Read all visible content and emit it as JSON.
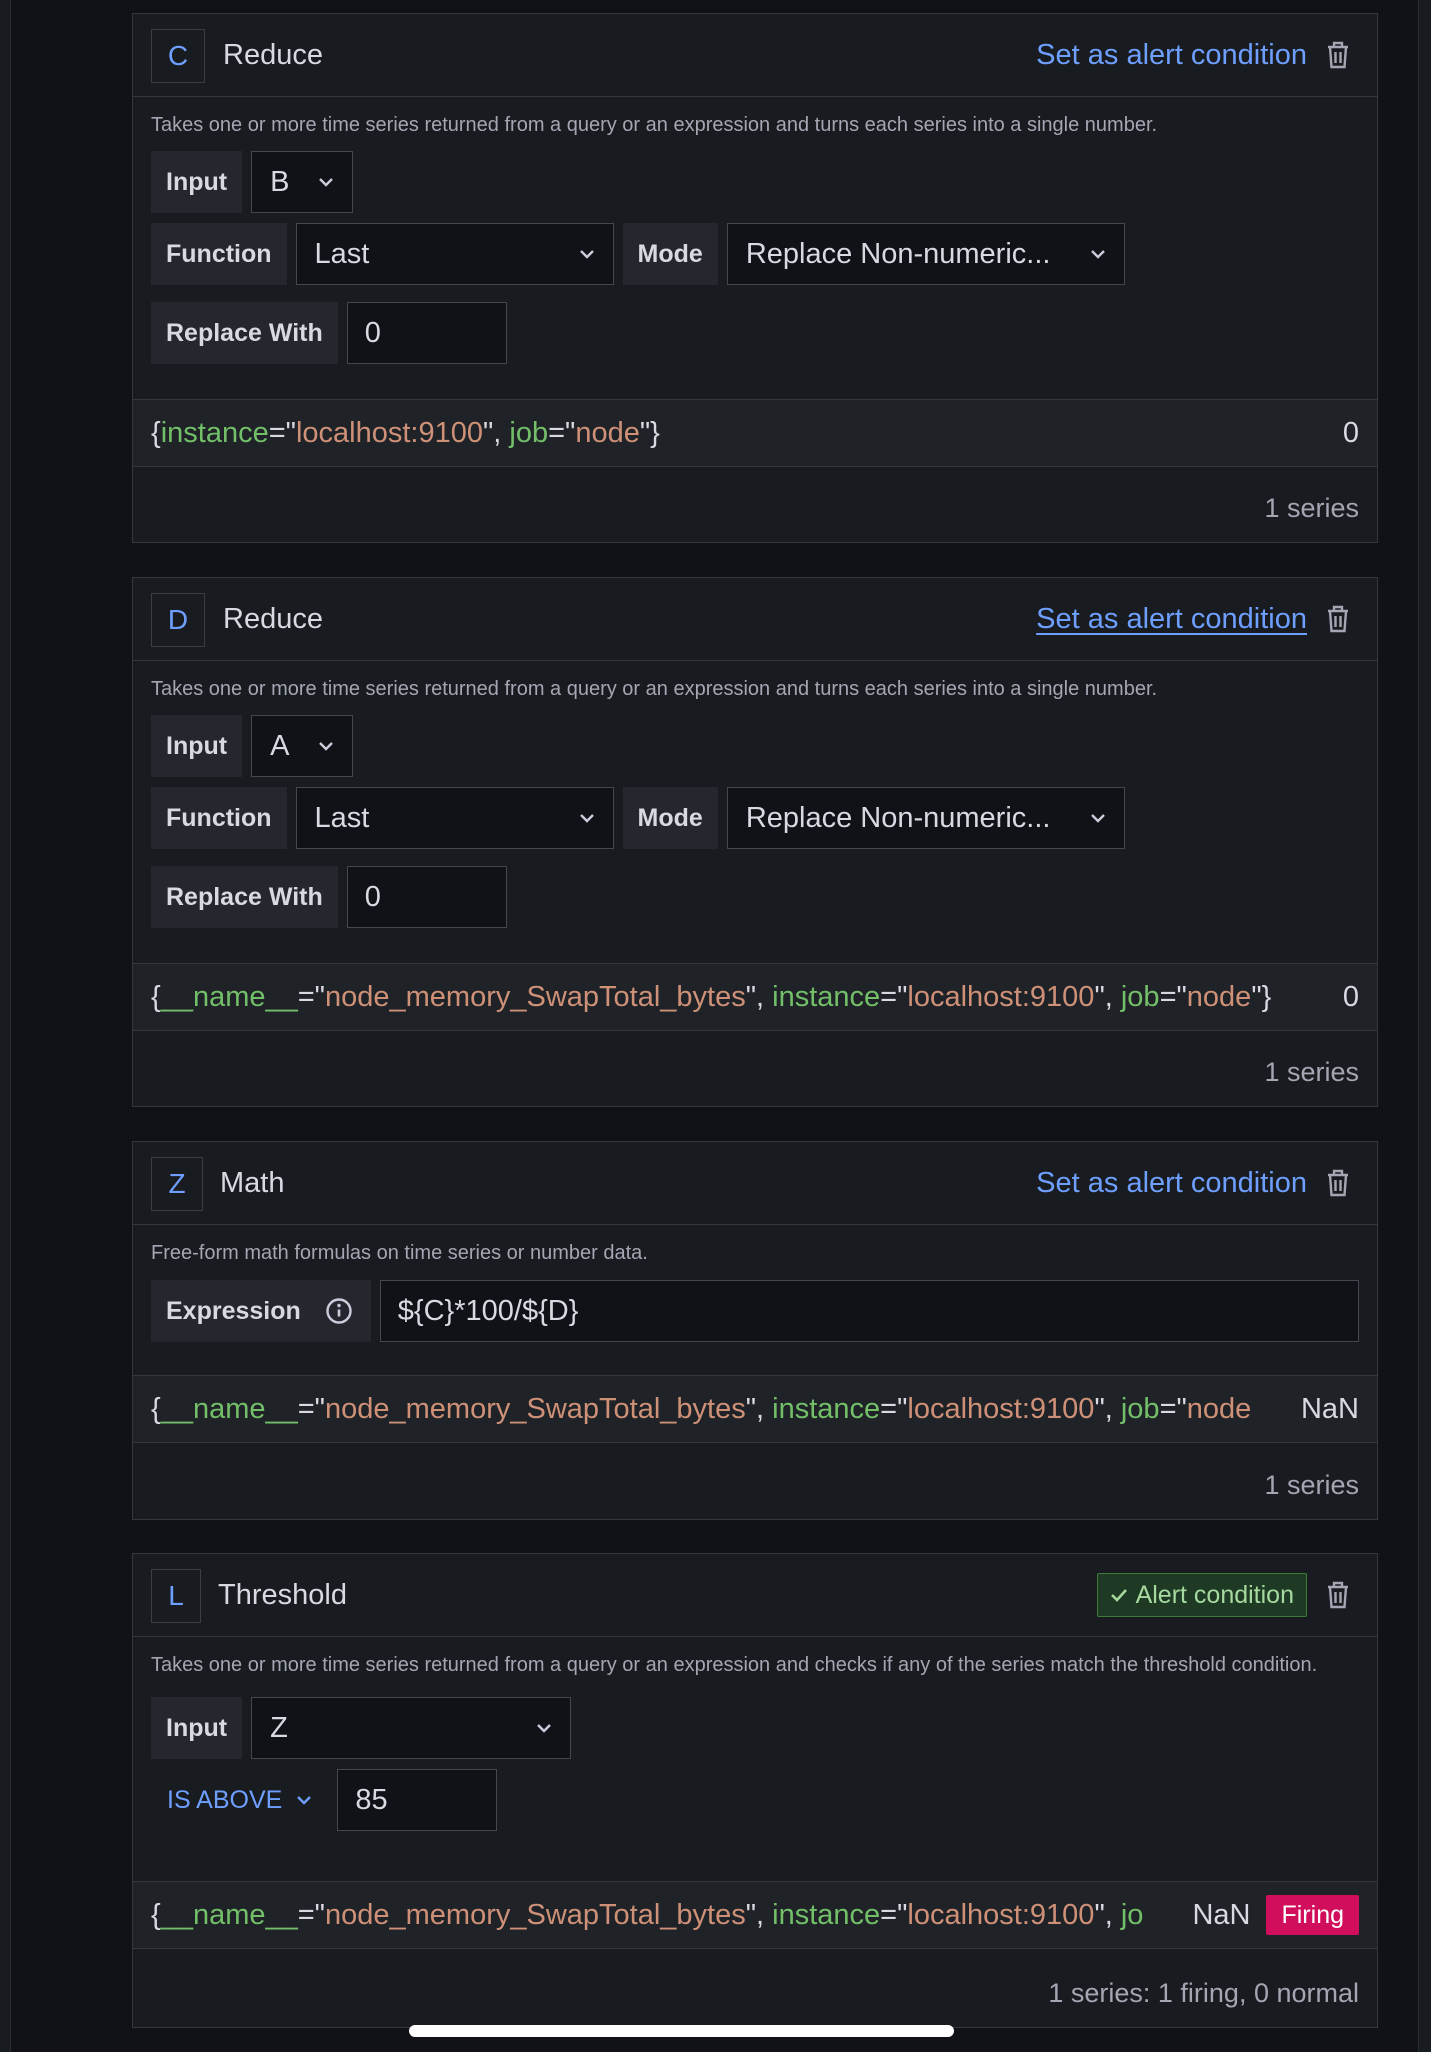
{
  "set_alert_label": "Set as alert condition",
  "cards": {
    "c": {
      "ref": "C",
      "type": "Reduce",
      "description": "Takes one or more time series returned from a query or an expression and turns each series into a single number.",
      "input_label": "Input",
      "input_value": "B",
      "function_label": "Function",
      "function_value": "Last",
      "mode_label": "Mode",
      "mode_value": "Replace Non-numeric...",
      "replace_label": "Replace With",
      "replace_value": "0",
      "series": {
        "open": "{",
        "k1": "instance",
        "eq1": "=\"",
        "v1": "localhost:9100",
        "sep1": "\", ",
        "k2": "job",
        "eq2": "=\"",
        "v2": "node",
        "close": "\"}",
        "value": "0"
      },
      "footer": "1 series"
    },
    "d": {
      "ref": "D",
      "type": "Reduce",
      "description": "Takes one or more time series returned from a query or an expression and turns each series into a single number.",
      "input_label": "Input",
      "input_value": "A",
      "function_label": "Function",
      "function_value": "Last",
      "mode_label": "Mode",
      "mode_value": "Replace Non-numeric...",
      "replace_label": "Replace With",
      "replace_value": "0",
      "series": {
        "open": "{",
        "k0": "__name__",
        "eq0": "=\"",
        "v0": "node_memory_SwapTotal_bytes",
        "sep0": "\", ",
        "k1": "instance",
        "eq1": "=\"",
        "v1": "localhost:9100",
        "sep1": "\", ",
        "k2": "job",
        "eq2": "=\"",
        "v2": "node",
        "close": "\"}",
        "value": "0"
      },
      "footer": "1 series"
    },
    "z": {
      "ref": "Z",
      "type": "Math",
      "description": "Free-form math formulas on time series or number data.",
      "expression_label": "Expression",
      "expression_value": "${C}*100/${D}",
      "series": {
        "open": "{",
        "k0": "__name__",
        "eq0": "=\"",
        "v0": "node_memory_SwapTotal_bytes",
        "sep0": "\", ",
        "k1": "instance",
        "eq1": "=\"",
        "v1": "localhost:9100",
        "sep1": "\", ",
        "k2": "job",
        "eq2": "=\"",
        "v2": "node",
        "value": "NaN"
      },
      "footer": "1 series"
    },
    "l": {
      "ref": "L",
      "type": "Threshold",
      "alert_badge": "Alert condition",
      "description": "Takes one or more time series returned from a query or an expression and checks if any of the series match the threshold condition.",
      "input_label": "Input",
      "input_value": "Z",
      "condition_label": "IS ABOVE",
      "threshold_value": "85",
      "series": {
        "open": "{",
        "k0": "__name__",
        "eq0": "=\"",
        "v0": "node_memory_SwapTotal_bytes",
        "sep0": "\", ",
        "k1": "instance",
        "eq1": "=\"",
        "v1": "localhost:9100",
        "sep1": "\", ",
        "k2": "jo",
        "value": "NaN",
        "state": "Firing"
      },
      "footer": "1 series: 1 firing, 0 normal"
    }
  }
}
